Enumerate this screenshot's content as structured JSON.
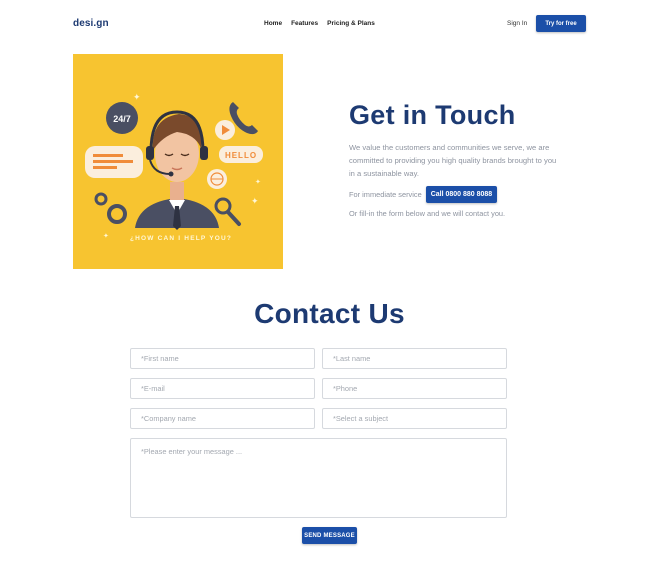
{
  "brand": {
    "logo": "desi.gn"
  },
  "nav": {
    "links": [
      "Home",
      "Features",
      "Pricing & Plans"
    ],
    "signin": "Sign In",
    "cta": "Try for free"
  },
  "hero": {
    "badge_24_7": "24/7",
    "hello_label": "HELLO",
    "caption": "¿HOW CAN I HELP YOU?",
    "title": "Get in Touch",
    "description": "We value the customers and communities we serve, we are committed to providing you high quality brands brought to you in a sustainable way.",
    "immediate_label": "For immediate service",
    "call_label": "Call  0800 880 8088",
    "fill_text": "Or fill-in the form below and we will contact you."
  },
  "contact": {
    "title": "Contact Us",
    "first_name_placeholder": "*First name",
    "last_name_placeholder": "*Last name",
    "email_placeholder": "*E-mail",
    "phone_placeholder": "*Phone",
    "company_placeholder": "*Company name",
    "subject_placeholder": "*Select a subject",
    "message_placeholder": "*Please enter your message ...",
    "send_label": "SEND MESSAGE"
  },
  "colors": {
    "brand_blue": "#1b4fa8",
    "title_navy": "#1d3a72",
    "hero_yellow": "#f7c430"
  }
}
